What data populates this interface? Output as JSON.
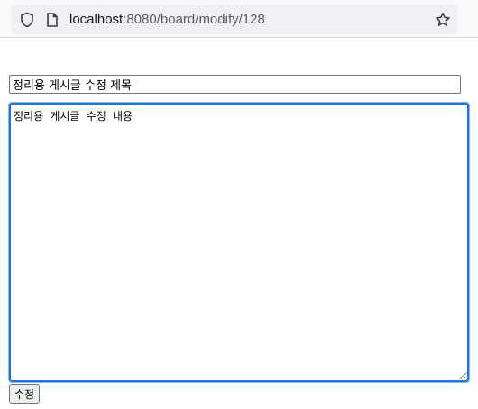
{
  "browser": {
    "url_host": "localhost",
    "url_path": ":8080/board/modify/128"
  },
  "form": {
    "title_value": "정리용 게시글 수정 제목",
    "content_value": "정리용 게시글 수정 내용",
    "submit_label": "수정"
  },
  "colors": {
    "focus_ring": "#1a73e8",
    "toolbar_bg": "#f9f9fb",
    "url_bar_bg": "#f0f0f4"
  },
  "icons": {
    "shield": "shield-icon",
    "page": "page-icon",
    "bookmark": "star-icon"
  }
}
